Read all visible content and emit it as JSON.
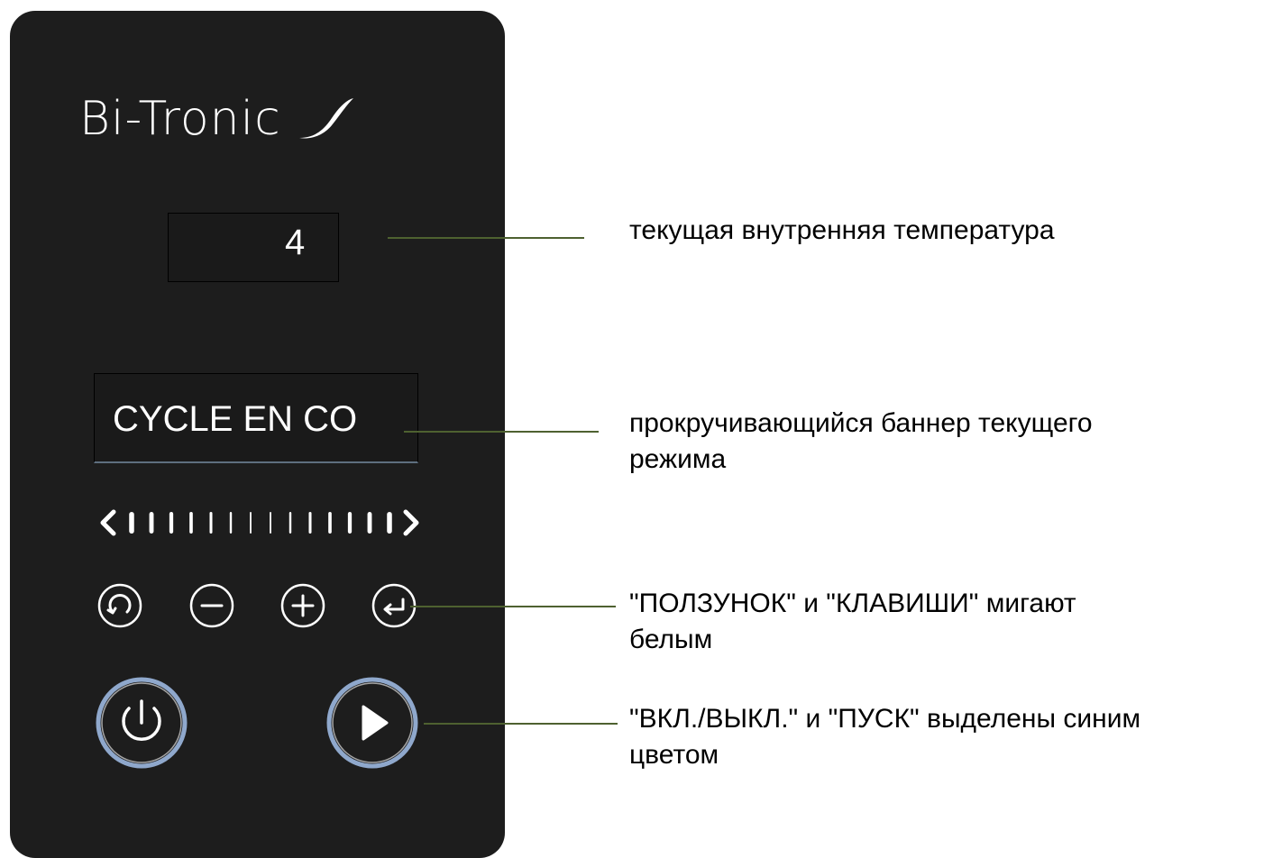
{
  "panel": {
    "brand": "Bi-Tronic",
    "brand_mark": "swoosh-icon",
    "temperature_value": "4",
    "banner_text": "CYCLE EN CO",
    "slider_ticks": 14,
    "keys": [
      {
        "name": "reload-icon"
      },
      {
        "name": "minus-icon"
      },
      {
        "name": "plus-icon"
      },
      {
        "name": "enter-icon"
      }
    ],
    "power_icon": "power-icon",
    "play_icon": "play-icon"
  },
  "colors": {
    "panel_bg": "#1d1d1d",
    "display_bg": "#1a1a1a",
    "highlight_ring": "#8fa8cc",
    "leader_line": "#4e6130",
    "icon_white": "#ffffff"
  },
  "callouts": {
    "temperature": {
      "line1": "текущая внутренняя температура"
    },
    "banner": {
      "line1": "прокручивающийся баннер текущего",
      "line2": "режима"
    },
    "slider_keys": {
      "line1": "\"ПОЛЗУНОК\" и \"КЛАВИШИ\" мигают",
      "line2": "белым"
    },
    "power_start": {
      "line1": "\"ВКЛ./ВЫКЛ.\" и \"ПУСК\" выделены синим",
      "line2": "цветом"
    }
  }
}
